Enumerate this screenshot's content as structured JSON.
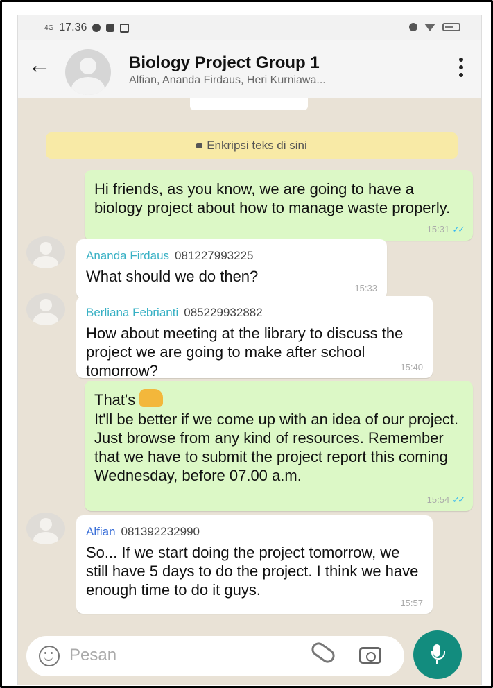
{
  "status_bar": {
    "network": "4G",
    "time": "17.36"
  },
  "header": {
    "title": "Biology Project Group 1",
    "subtitle": "Alfian, Ananda Firdaus, Heri Kurniawa...",
    "back_icon": "arrow-left-icon",
    "menu_icon": "more-vertical-icon"
  },
  "encryption_notice": "Enkripsi teks di sini",
  "messages": [
    {
      "direction": "outgoing",
      "text": "Hi friends, as you know, we are going to have a biology project about how to manage waste properly.",
      "time": "15:31"
    },
    {
      "direction": "incoming",
      "sender": "Ananda Firdaus",
      "phone": "081227993225",
      "text": "What should we do then?",
      "time": "15:33"
    },
    {
      "direction": "incoming",
      "sender": "Berliana Febrianti",
      "phone": "085229932882",
      "text": "How about meeting  at the library to discuss the project we are going to make after school tomorrow?",
      "time": "15:40"
    },
    {
      "direction": "outgoing",
      "text_first": "That's",
      "emoji": "thumbs-up-icon",
      "text": "It'll be better if we come up with an idea of our project. Just browse from any kind of resources. Remember that we have to submit the project report this coming Wednesday, before 07.00 a.m.",
      "time": "15:54"
    },
    {
      "direction": "incoming",
      "sender": "Alfian",
      "phone": "081392232990",
      "text": "So... If we start doing the project tomorrow, we still have 5 days to do the project. I think we have enough time to do it guys.",
      "time": "15:57"
    }
  ],
  "input": {
    "placeholder": "Pesan",
    "emoji_icon": "emoji-icon",
    "attach_icon": "paperclip-icon",
    "camera_icon": "camera-icon",
    "mic_icon": "microphone-icon"
  },
  "colors": {
    "outgoing_bubble": "#dcf8c6",
    "incoming_bubble": "#ffffff",
    "chat_background": "#e9e2d6",
    "mic_button": "#128c7e",
    "read_ticks": "#34b7f1"
  }
}
